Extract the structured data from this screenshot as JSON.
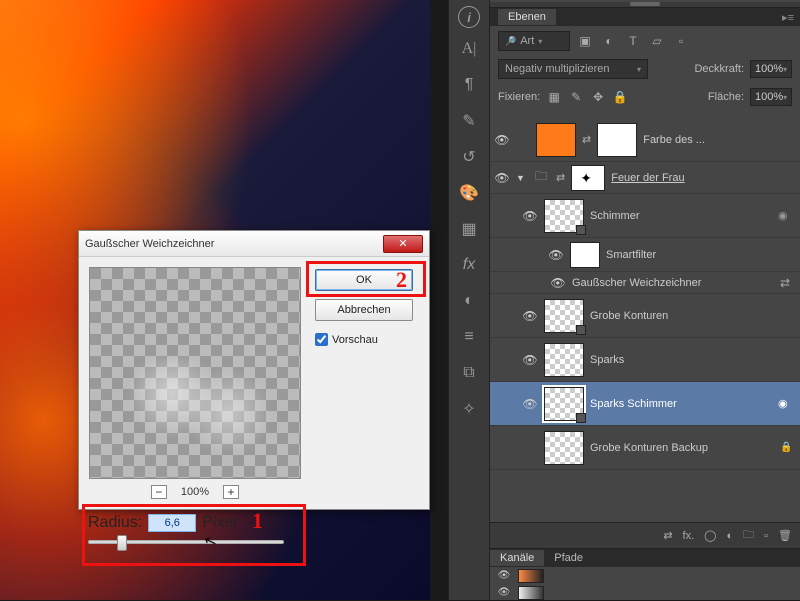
{
  "dialog": {
    "title": "Gaußscher Weichzeichner",
    "ok": "OK",
    "cancel": "Abbrechen",
    "preview_label": "Vorschau",
    "zoom_pct": "100%",
    "radius_label": "Radius:",
    "radius_value": "6,6",
    "radius_unit": "Pixel",
    "anno1": "1",
    "anno2": "2"
  },
  "panel": {
    "tab": "Ebenen",
    "art_label": "Art",
    "blend_mode": "Negativ multiplizieren",
    "opacity_label": "Deckkraft:",
    "opacity_value": "100%",
    "fix_label": "Fixieren:",
    "fill_label": "Fläche:",
    "fill_value": "100%"
  },
  "layers": {
    "l0": "Farbe des ...",
    "l1": "Feuer der Frau",
    "l2": "Schimmer",
    "l3": "Smartfilter",
    "l4": "Gaußscher Weichzeichner",
    "l5": "Grobe Konturen",
    "l6": "Sparks",
    "l7": "Sparks Schimmer",
    "l8": "Grobe Konturen Backup"
  },
  "footer": {
    "fx": "fx."
  },
  "bottom": {
    "t1": "Kanäle",
    "t2": "Pfade"
  }
}
